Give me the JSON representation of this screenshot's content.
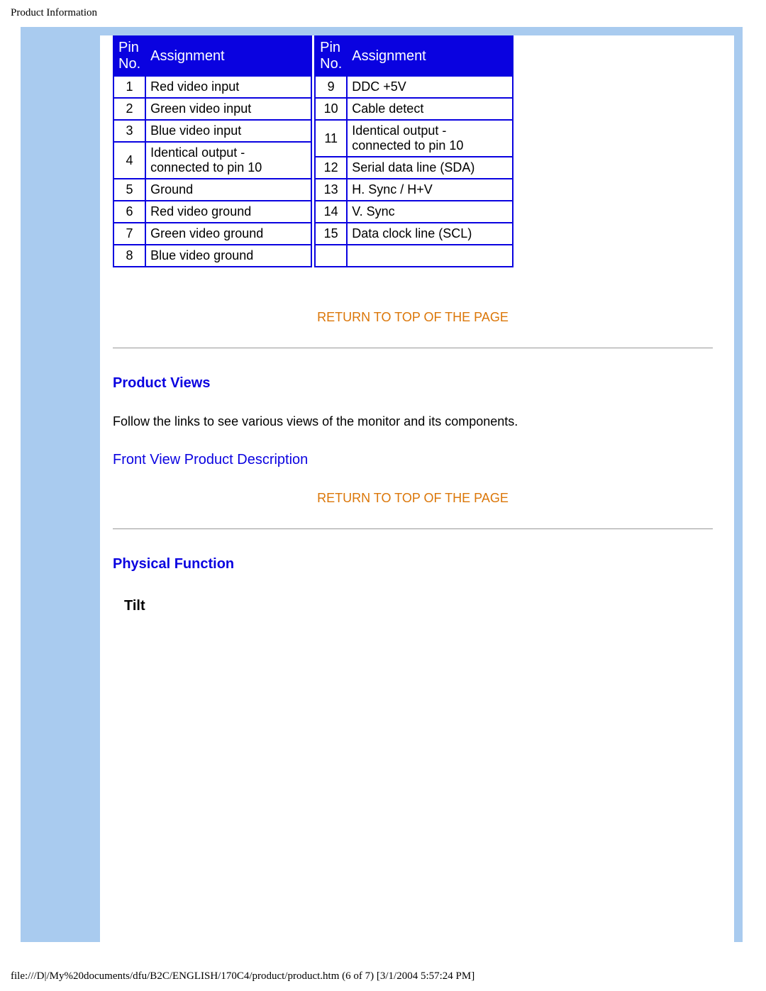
{
  "header": "Product Information",
  "table_headers": {
    "col1": "Pin No.",
    "col2": "Assignment"
  },
  "left_rows": [
    {
      "pin": "1",
      "assign": "Red video input"
    },
    {
      "pin": "2",
      "assign": "Green video input"
    },
    {
      "pin": "3",
      "assign": "Blue video input"
    },
    {
      "pin": "4",
      "assign": "Identical output - connected to pin 10"
    },
    {
      "pin": "5",
      "assign": "Ground"
    },
    {
      "pin": "6",
      "assign": "Red video ground"
    },
    {
      "pin": "7",
      "assign": "Green video ground"
    },
    {
      "pin": "8",
      "assign": "Blue video ground"
    }
  ],
  "right_rows": [
    {
      "pin": "9",
      "assign": "DDC +5V"
    },
    {
      "pin": "10",
      "assign": "Cable detect"
    },
    {
      "pin": "11",
      "assign": "Identical output - connected to pin 10"
    },
    {
      "pin": "12",
      "assign": "Serial data line (SDA)"
    },
    {
      "pin": "13",
      "assign": "H. Sync / H+V"
    },
    {
      "pin": "14",
      "assign": "V. Sync"
    },
    {
      "pin": "15",
      "assign": "Data clock line (SCL)"
    }
  ],
  "return_link": "RETURN TO TOP OF THE PAGE",
  "sections": {
    "product_views": {
      "heading": "Product Views",
      "body": "Follow the links to see various views of the monitor and its components.",
      "link": "Front View Product Description"
    },
    "physical_function": {
      "heading": "Physical Function",
      "sub": "Tilt"
    }
  },
  "footer": "file:///D|/My%20documents/dfu/B2C/ENGLISH/170C4/product/product.htm (6 of 7) [3/1/2004 5:57:24 PM]",
  "colors": {
    "deep_blue": "#0a02e0",
    "orange": "#db7608",
    "light_blue": "#a9cbef"
  }
}
